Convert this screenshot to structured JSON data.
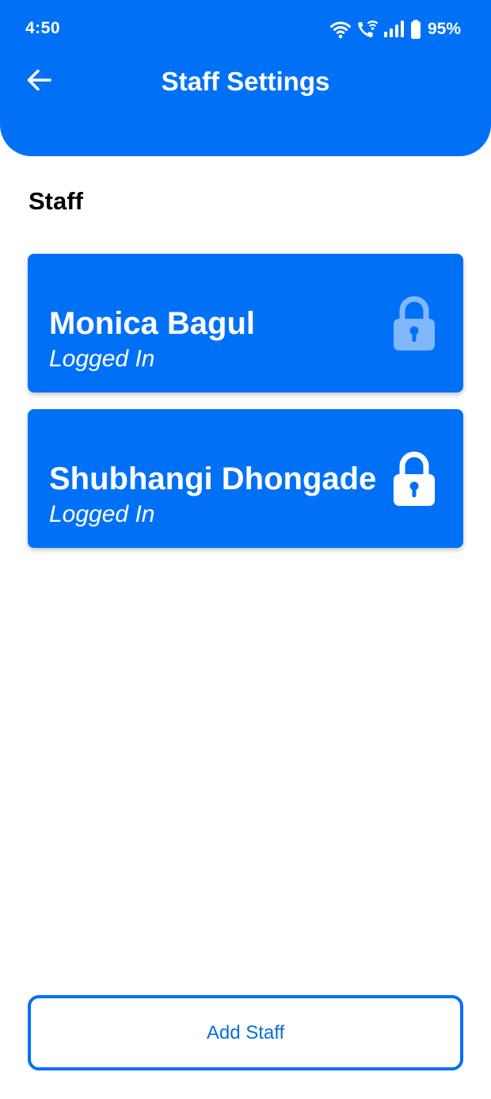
{
  "status_bar": {
    "time": "4:50",
    "battery_percent": "95%",
    "icons": [
      "wifi-icon",
      "wifi-call-icon",
      "signal-icon",
      "battery-icon"
    ]
  },
  "header": {
    "title": "Staff Settings",
    "back_icon": "arrow-left-icon"
  },
  "section": {
    "title": "Staff"
  },
  "staff": [
    {
      "name": "Monica Bagul",
      "status": "Logged In",
      "lock_icon": "lock-icon",
      "lock_state": "dimmed"
    },
    {
      "name": "Shubhangi Dhongade",
      "status": "Logged In",
      "lock_icon": "lock-icon",
      "lock_state": "active"
    }
  ],
  "actions": {
    "add_staff_label": "Add Staff"
  },
  "colors": {
    "primary": "#0071F7",
    "background": "#FFFFFF",
    "text_on_primary": "#FFFFFF",
    "button_text": "#0A6FD8"
  }
}
